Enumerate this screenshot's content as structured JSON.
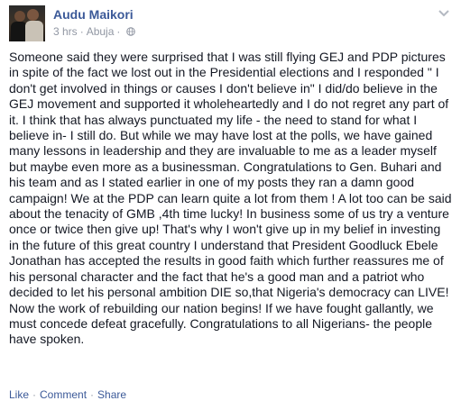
{
  "post": {
    "author": "Audu Maikori",
    "time": "3 hrs",
    "separator": "·",
    "location": "Abuja",
    "privacy_icon": "globe-icon",
    "menu_icon": "chevron-down-icon",
    "text": "Someone said they were surprised that I was still flying GEJ and PDP pictures in spite of the fact we lost out in the Presidential elections and I responded \" I don't get involved in things or causes I don't believe in\" I did/do believe in the GEJ movement and supported it wholeheartedly and I do not regret any part of it. I think that has always punctuated my life - the need to stand for what I believe in- I still do. But while we may have lost at the polls, we have gained many lessons in leadership and they are invaluable to me as a leader myself but maybe even more as a businessman. Congratulations to Gen. Buhari and his team and as I stated earlier in one of my posts they ran a damn good campaign! We at the PDP can learn quite a lot from them ! A lot too can be said about the tenacity of GMB ,4th time lucky! In business some of us try a venture once or twice then give up! That's why I won't give up in my belief in investing in the future of this great country I understand that President Goodluck Ebele Jonathan has accepted the results in good faith which further reassures me of his personal character and the fact that he's a good man and a patriot who decided to let his personal ambition DIE so,that Nigeria's democracy can LIVE! Now the work of rebuilding our nation begins! If we have fought gallantly, we must concede defeat gracefully. Congratulations to all Nigerians- the people have spoken."
  },
  "actions": {
    "like": "Like",
    "comment": "Comment",
    "share": "Share",
    "separator": "·"
  },
  "colors": {
    "link": "#3b5998",
    "meta": "#9197a3",
    "text": "#141823"
  }
}
